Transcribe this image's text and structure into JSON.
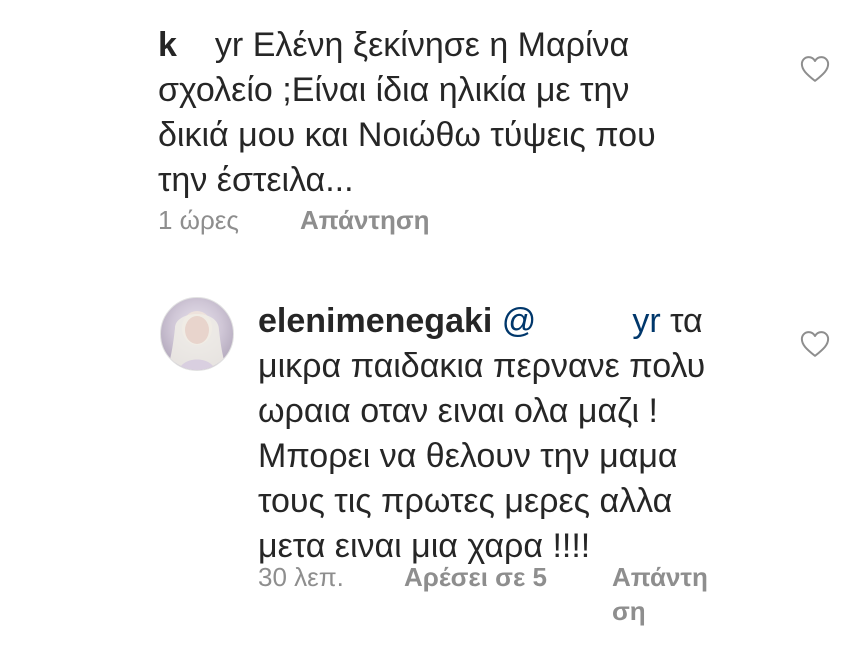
{
  "comments": [
    {
      "username": "k",
      "username_tail": "yr",
      "text_lines": [
        "Ελένη ξεκίνησε η Μαρίνα",
        "σχολείο ;Είναι ίδια ηλικία με την",
        "δικιά μου και Νοιώθω τύψεις που",
        "την έστειλα..."
      ],
      "time": "1 ώρες",
      "reply_label": "Απάντηση",
      "like_icon": "heart-outline-icon"
    },
    {
      "username": "elenimenegaki",
      "mention_prefix": "@",
      "mention_tail": "yr",
      "first_line_tail": "τα",
      "text_lines": [
        "μικρα παιδακια περνανε πολυ",
        "ωραια οταν ειναι ολα μαζι !",
        "Μπορει να θελουν την μαμα",
        "τους τις πρωτες μερες αλλα",
        "μετα ειναι μια χαρα !!!!"
      ],
      "time": "30 λεπ.",
      "likes_label": "Αρέσει σε 5",
      "reply_label_part1": "Απάντη",
      "reply_label_part2": "ση",
      "like_icon": "heart-outline-icon",
      "avatar": "avatar"
    }
  ],
  "colors": {
    "text": "#262626",
    "meta": "#8e8e8e",
    "mention": "#00376b",
    "icon": "#8e8e8e"
  }
}
